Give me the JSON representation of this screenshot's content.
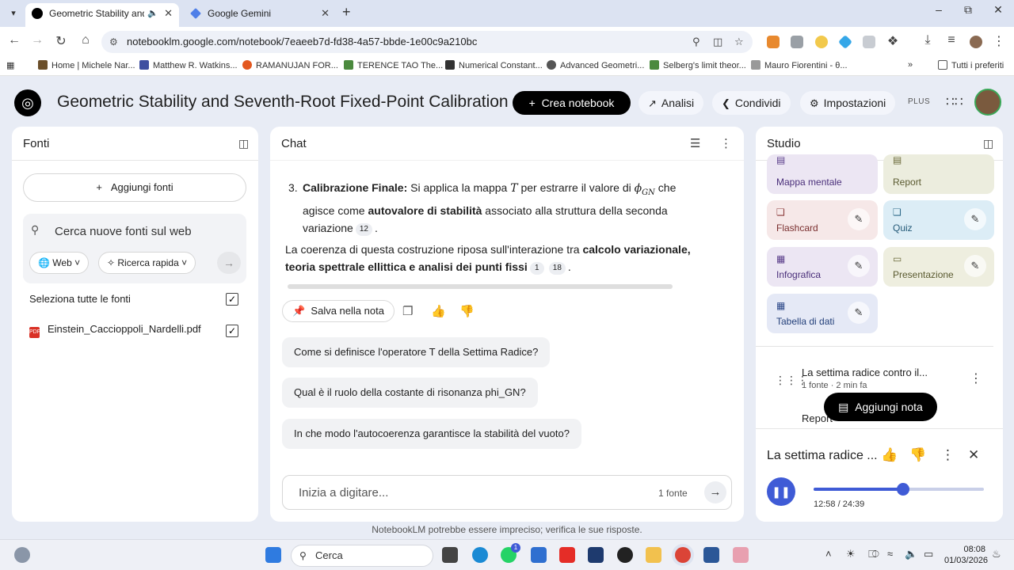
{
  "browser": {
    "tabs": [
      {
        "title": "Geometric Stability and Sev"
      },
      {
        "title": "Google Gemini"
      }
    ],
    "url": "notebooklm.google.com/notebook/7eaeeb7d-fd38-4a57-bbde-1e00c9a210bc",
    "bookmarks": [
      "Home | Michele Nar...",
      "Matthew R. Watkins...",
      "RAMANUJAN FOR...",
      "TERENCE TAO  The...",
      "Numerical Constant...",
      "Advanced Geometri...",
      "Selberg's limit theor...",
      "Mauro Fiorentini - θ...",
      "Tutti i preferiti"
    ]
  },
  "header": {
    "notebook_title": "Geometric Stability and Seventh-Root Fixed-Point Calibration",
    "create_label": "Crea notebook",
    "analisi_label": "Analisi",
    "condividi_label": "Condividi",
    "impostazioni_label": "Impostazioni",
    "plan_badge": "PLUS"
  },
  "fonti": {
    "title": "Fonti",
    "add_label": "Aggiungi fonti",
    "search_placeholder": "Cerca nuove fonti sul web",
    "chip_web": "Web",
    "chip_ricerca": "Ricerca rapida",
    "select_all_label": "Seleziona tutte le fonti",
    "sources": [
      {
        "name": "Einstein_Caccioppoli_Nardelli.pdf",
        "checked": true
      }
    ]
  },
  "chat": {
    "title": "Chat",
    "item3": {
      "number": "3.",
      "head": "Calibrazione Finale:",
      "t1": " Si applica la mappa ",
      "var_T": "T",
      "t2": " per estrarre il valore di ",
      "var_phi": "ϕ",
      "var_sub": "GN",
      "t3": " che agisce come ",
      "bold": "autovalore di stabilità",
      "t4": " associato alla struttura della seconda variazione",
      "cite": "12",
      "end": "."
    },
    "para": {
      "t1": "La coerenza di questa costruzione riposa sull'interazione tra ",
      "bold": "calcolo variazionale, teoria spettrale ellittica e analisi dei punti fissi",
      "cite1": "1",
      "cite2": "18",
      "end": "."
    },
    "save_label": "Salva nella nota",
    "suggestions": [
      "Come si definisce l'operatore T della Settima Radice?",
      "Qual è il ruolo della costante di risonanza phi_GN?",
      "In che modo l'autocoerenza garantisce la stabilità del vuoto?"
    ],
    "input_placeholder": "Inizia a digitare...",
    "source_count": "1 fonte"
  },
  "studio": {
    "title": "Studio",
    "tiles": [
      {
        "label": "Mappa mentale",
        "color": "#ece6f3"
      },
      {
        "label": "Report",
        "color": "#ecedde"
      },
      {
        "label": "Flashcard",
        "color": "#f6e8e8"
      },
      {
        "label": "Quiz",
        "color": "#dcedf6"
      },
      {
        "label": "Infografica",
        "color": "#ece6f3"
      },
      {
        "label": "Presentazione",
        "color": "#eeeedf"
      },
      {
        "label": "Tabella di dati",
        "color": "#e5e9f6"
      }
    ],
    "note": {
      "title": "La settima radice contro il...",
      "meta": "1 fonte · 2 min fa"
    },
    "partial_note": "Report",
    "add_note_label": "Aggiungi nota",
    "player": {
      "title": "La settima radice ...",
      "elapsed": "12:58",
      "total": "24:39",
      "progress": 0.526
    }
  },
  "disclaimer": "NotebookLM potrebbe essere impreciso; verifica le sue risposte.",
  "taskbar": {
    "search_label": "Cerca",
    "whatsapp_badge": "1",
    "time": "08:08",
    "date": "01/03/2026"
  }
}
